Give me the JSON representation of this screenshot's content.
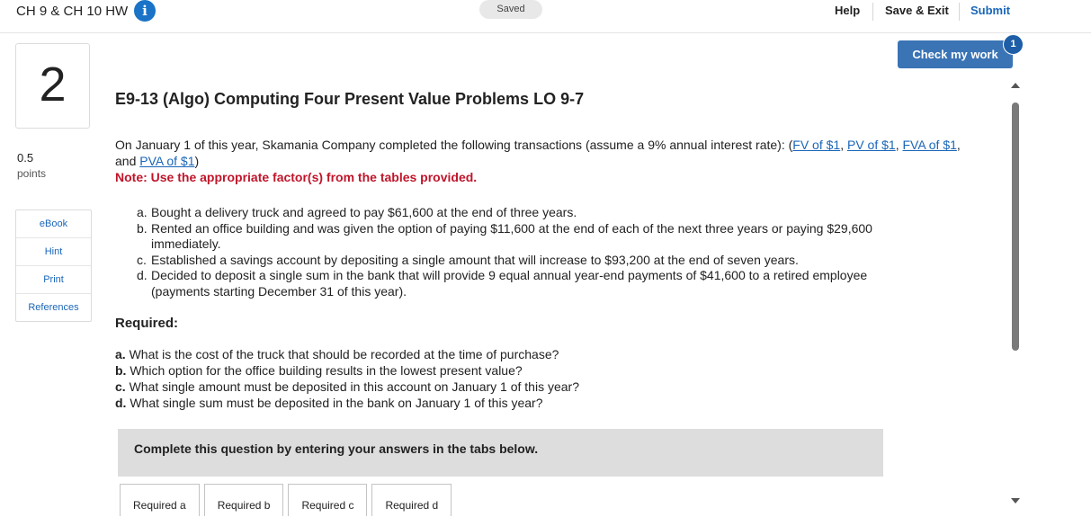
{
  "header": {
    "assignment_title": "CH 9 & CH 10 HW",
    "info_icon": "i",
    "saved_label": "Saved",
    "help_label": "Help",
    "save_exit_label": "Save & Exit",
    "submit_label": "Submit"
  },
  "check_work": {
    "label": "Check my work",
    "badge": "1"
  },
  "question": {
    "number": "2",
    "points_value": "0.5",
    "points_label": "points",
    "title": "E9-13 (Algo) Computing Four Present Value Problems LO 9-7",
    "intro_text": "On January 1 of this year, Skamania Company completed the following transactions (assume a 9% annual interest rate): (",
    "links": [
      "FV of $1",
      "PV of $1",
      "FVA of $1",
      "PVA of $1"
    ],
    "intro_sep1": ", ",
    "intro_sep2": ", ",
    "intro_sep3": ", and ",
    "intro_end": ")",
    "note": "Note: Use the appropriate factor(s) from the tables provided.",
    "transactions": [
      {
        "letter": "a.",
        "text": "Bought a delivery truck and agreed to pay $61,600 at the end of three years."
      },
      {
        "letter": "b.",
        "text": "Rented an office building and was given the option of paying $11,600 at the end of each of the next three years or paying $29,600 immediately."
      },
      {
        "letter": "c.",
        "text": "Established a savings account by depositing a single amount that will increase to $93,200 at the end of seven years."
      },
      {
        "letter": "d.",
        "text": "Decided to deposit a single sum in the bank that will provide 9 equal annual year-end payments of $41,600 to a retired employee (payments starting December 31 of this year)."
      }
    ],
    "required_heading": "Required:",
    "requirements": [
      {
        "letter": "a.",
        "text": "What is the cost of the truck that should be recorded at the time of purchase?"
      },
      {
        "letter": "b.",
        "text": "Which option for the office building results in the lowest present value?"
      },
      {
        "letter": "c.",
        "text": "What single amount must be deposited in this account on January 1 of this year?"
      },
      {
        "letter": "d.",
        "text": "What single sum must be deposited in the bank on January 1 of this year?"
      }
    ],
    "instructions": "Complete this question by entering your answers in the tabs below.",
    "tabs": [
      "Required a",
      "Required b",
      "Required c",
      "Required d"
    ]
  },
  "side_tools": [
    "eBook",
    "Hint",
    "Print",
    "References"
  ],
  "colors": {
    "accent": "#3a74b5",
    "link": "#1a66b8",
    "note_red": "#c0152a"
  }
}
